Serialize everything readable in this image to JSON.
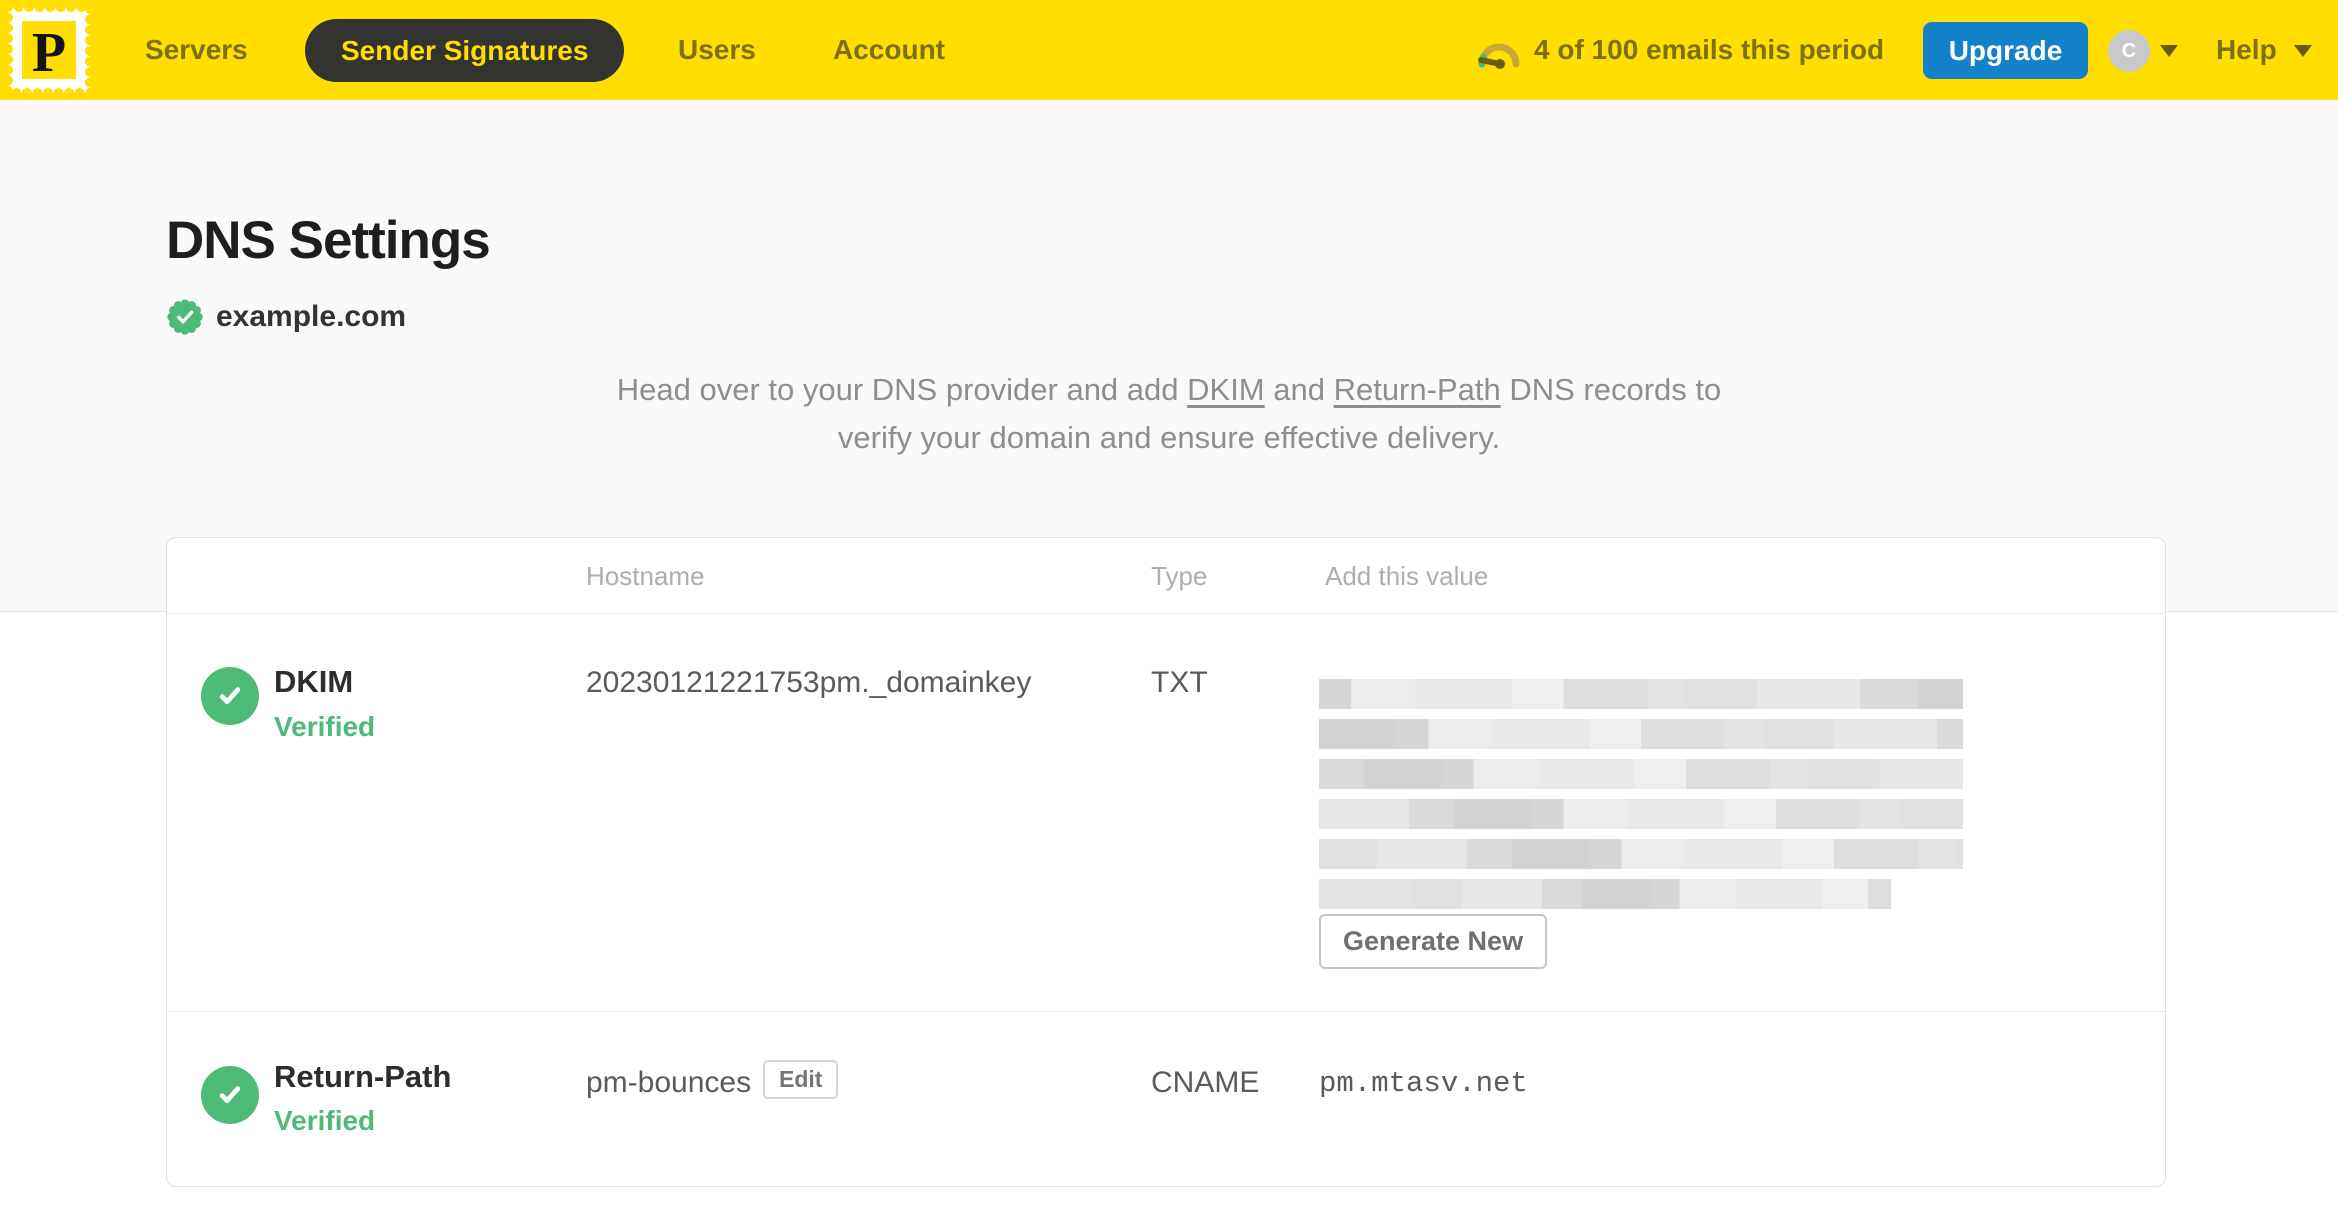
{
  "nav": {
    "logo_letter": "P",
    "items": [
      {
        "label": "Servers",
        "active": false
      },
      {
        "label": "Sender Signatures",
        "active": true
      },
      {
        "label": "Users",
        "active": false
      },
      {
        "label": "Account",
        "active": false
      }
    ],
    "usage_text": "4 of 100 emails this period",
    "upgrade_label": "Upgrade",
    "avatar_initial": "C",
    "help_label": "Help"
  },
  "colors": {
    "brand_yellow": "#FFDE00",
    "nav_text_olive": "#7E6E14",
    "active_pill_bg": "#33332F",
    "upgrade_blue": "#1482C8",
    "verified_green": "#4DBA77",
    "hero_bg": "#FAFAFA"
  },
  "page": {
    "title": "DNS Settings",
    "domain": "example.com",
    "description": {
      "part1": "Head over to your DNS provider and add ",
      "link1": "DKIM",
      "part2": " and ",
      "link2": "Return-Path",
      "part3": " DNS records to",
      "part4": "verify your domain and ensure effective delivery."
    }
  },
  "table": {
    "headers": {
      "hostname": "Hostname",
      "type": "Type",
      "value": "Add this value"
    },
    "rows": [
      {
        "name": "DKIM",
        "status": "Verified",
        "hostname": "20230121221753pm._domainkey",
        "type": "TXT",
        "value_redacted": true,
        "action_label": "Generate New"
      },
      {
        "name": "Return-Path",
        "status": "Verified",
        "hostname": "pm-bounces",
        "edit_label": "Edit",
        "type": "CNAME",
        "value": "pm.mtasv.net"
      }
    ],
    "redaction_rows": 6
  }
}
